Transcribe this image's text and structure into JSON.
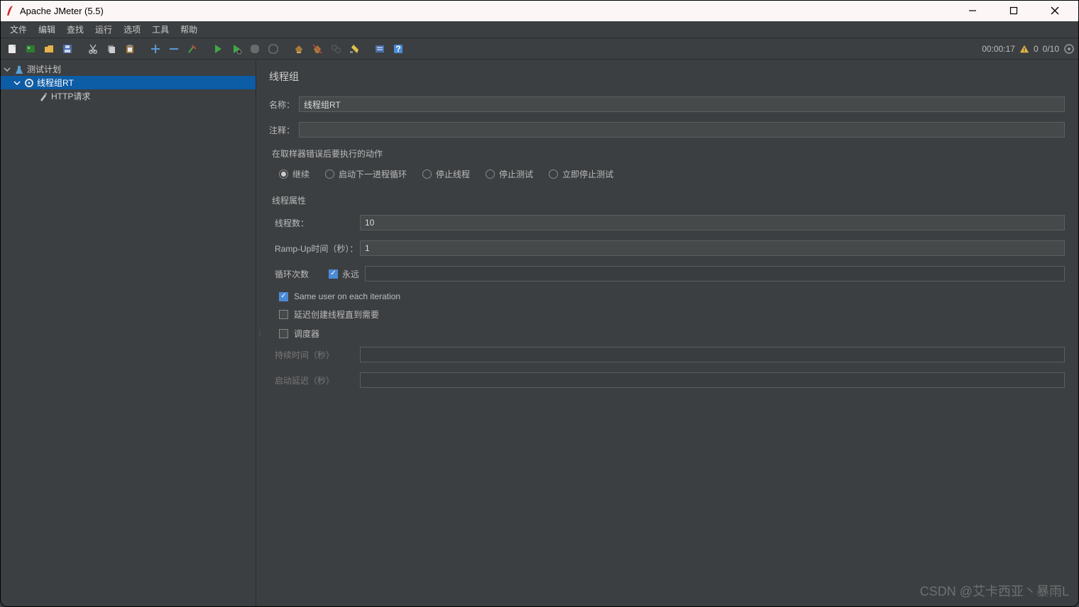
{
  "window": {
    "title": "Apache JMeter (5.5)"
  },
  "menu": {
    "file": "文件",
    "edit": "编辑",
    "search": "查找",
    "run": "运行",
    "options": "选项",
    "tools": "工具",
    "help": "帮助"
  },
  "status": {
    "time": "00:00:17",
    "warn_count": "0",
    "threads": "0/10"
  },
  "tree": {
    "plan": "测试计划",
    "group": "线程组RT",
    "sampler": "HTTP请求"
  },
  "panel": {
    "title": "线程组",
    "name_label": "名称：",
    "name_value": "线程组RT",
    "comment_label": "注释：",
    "comment_value": "",
    "on_error_label": "在取样器错误后要执行的动作",
    "radios": {
      "continue": "继续",
      "next_loop": "启动下一进程循环",
      "stop_thread": "停止线程",
      "stop_test": "停止测试",
      "stop_now": "立即停止测试"
    },
    "props_label": "线程属性",
    "threads_label": "线程数：",
    "threads_value": "10",
    "ramp_label": "Ramp-Up时间（秒）：",
    "ramp_value": "1",
    "loop_label": "循环次数",
    "forever": "永远",
    "same_user": "Same user on each iteration",
    "delay_create": "延迟创建线程直到需要",
    "scheduler": "调度器",
    "duration_label": "持续时间（秒）",
    "duration_value": "",
    "startup_label": "启动延迟（秒）",
    "startup_value": ""
  },
  "watermark": "CSDN @艾卡西亚丶暴雨L"
}
